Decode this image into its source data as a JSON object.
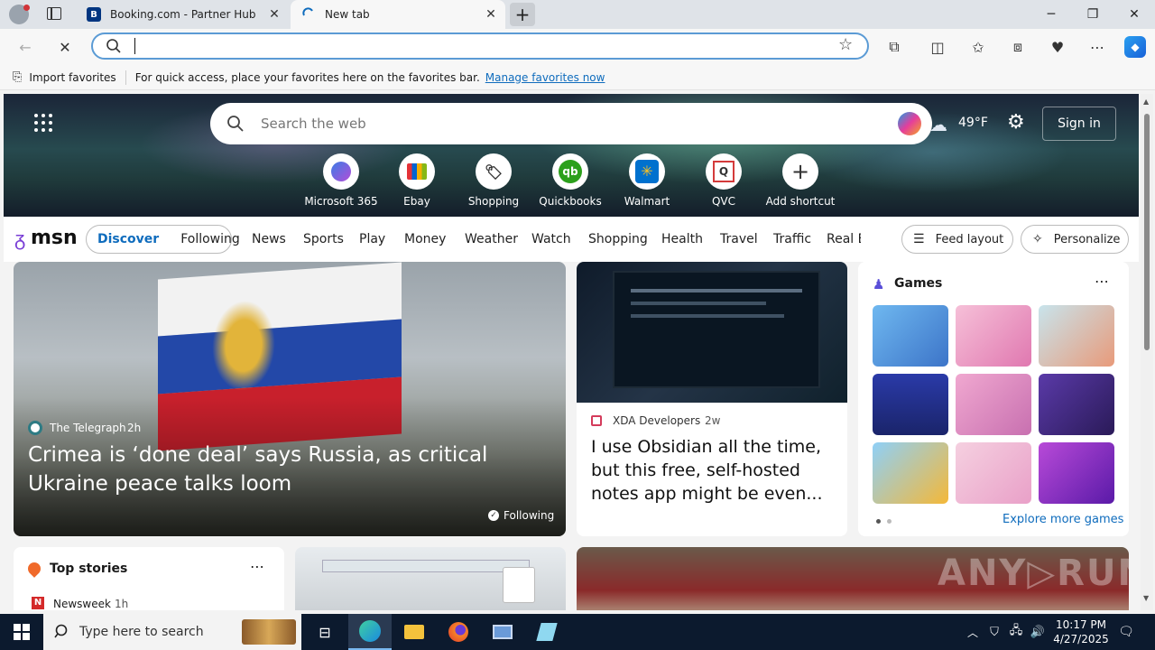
{
  "tabs": [
    {
      "title": "Booking.com - Partner Hub",
      "favicon": "B"
    },
    {
      "title": "New tab"
    }
  ],
  "address": {
    "value": ""
  },
  "favbar": {
    "import": "Import favorites",
    "message": "For quick access, place your favorites here on the favorites bar.",
    "manage_link": "Manage favorites now"
  },
  "hero": {
    "search_placeholder": "Search the web",
    "weather": "49°F",
    "sign_in": "Sign in",
    "shortcuts": [
      "Microsoft 365",
      "Ebay",
      "Shopping",
      "Quickbooks",
      "Walmart",
      "QVC",
      "Add shortcut"
    ]
  },
  "msn": {
    "logo": "msn",
    "tabs": [
      "Discover",
      "Following"
    ],
    "nav": [
      "News",
      "Sports",
      "Play",
      "Money",
      "Weather",
      "Watch",
      "Shopping",
      "Health",
      "Travel",
      "Traffic",
      "Real E"
    ],
    "feed_layout": "Feed layout",
    "personalize": "Personalize"
  },
  "hero_story": {
    "source": "The Telegraph",
    "age": "2h",
    "headline": "Crimea is ‘done deal’ says Russia, as critical Ukraine peace talks loom",
    "following": "Following"
  },
  "side_story": {
    "source": "XDA Developers",
    "age": "2w",
    "headline": "I use Obsidian all the time, but this free, self-hosted notes app might be even..."
  },
  "games": {
    "title": "Games",
    "explore": "Explore more games"
  },
  "top_stories": {
    "title": "Top stories",
    "first_source": "Newsweek",
    "first_age": "1h"
  },
  "taskbar": {
    "search_placeholder": "Type here to search",
    "time": "10:17 PM",
    "date": "4/27/2025"
  },
  "colors": {
    "accent": "#0f6cbd",
    "taskbar": "#0c1a2e",
    "address_focus": "#5b9bd5"
  }
}
